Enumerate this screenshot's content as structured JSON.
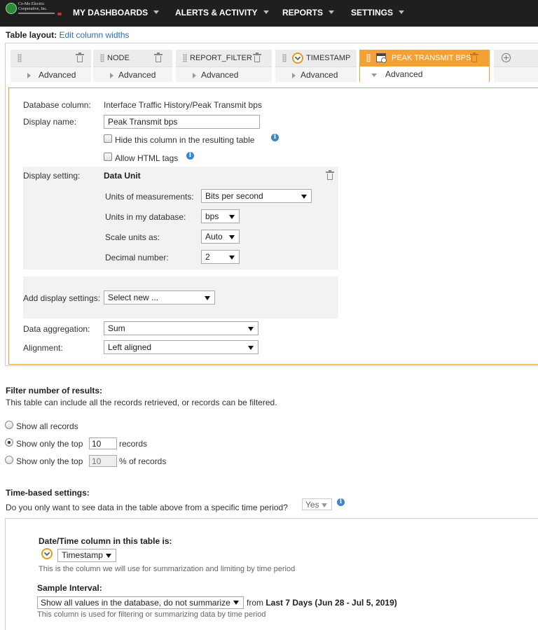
{
  "logo": {
    "line1": "Co-Mo Electric",
    "line2": "Cooperative, Inc."
  },
  "nav": [
    {
      "label": "MY DASHBOARDS"
    },
    {
      "label": "ALERTS & ACTIVITY"
    },
    {
      "label": "REPORTS"
    },
    {
      "label": "SETTINGS"
    }
  ],
  "table_layout": {
    "label": "Table layout:",
    "link": "Edit column widths"
  },
  "columns": [
    {
      "title": "",
      "sub": "Advanced"
    },
    {
      "title": "NODE",
      "sub": "Advanced"
    },
    {
      "title": "REPORT_FILTER",
      "sub": "Advanced"
    },
    {
      "title": "TIMESTAMP",
      "sub": "Advanced"
    },
    {
      "title": "PEAK TRANSMIT BPS",
      "sub": "Advanced"
    }
  ],
  "editor": {
    "db_column_label": "Database column:",
    "db_column_value": "Interface Traffic History/Peak Transmit bps",
    "display_name_label": "Display name:",
    "display_name_value": "Peak Transmit bps",
    "hide_label": "Hide this column in the resulting table",
    "html_label": "Allow HTML tags",
    "display_setting_label": "Display setting:",
    "data_unit_title": "Data Unit",
    "units_label": "Units of measurements:",
    "units_value": "Bits per second",
    "db_units_label": "Units in my database:",
    "db_units_value": "bps",
    "scale_label": "Scale units as:",
    "scale_value": "Auto",
    "decimal_label": "Decimal number:",
    "decimal_value": "2",
    "add_display_label": "Add display settings:",
    "add_display_value": "Select new ...",
    "aggregation_label": "Data aggregation:",
    "aggregation_value": "Sum",
    "alignment_label": "Alignment:",
    "alignment_value": "Left aligned"
  },
  "filter": {
    "title": "Filter number of results:",
    "desc": "This table can include all the records retrieved, or records can be filtered.",
    "opt_all": "Show all records",
    "opt_top_prefix": "Show only the top",
    "opt_top_value": "10",
    "opt_top_suffix": "records",
    "opt_pct_prefix": "Show only the top",
    "opt_pct_value": "10",
    "opt_pct_suffix": "% of records"
  },
  "time": {
    "title": "Time-based settings:",
    "question": "Do you only want to see data in the table above from a specific time period?",
    "question_value": "Yes",
    "datetime_label": "Date/Time column in this table is:",
    "datetime_value": "Timestamp",
    "datetime_hint": "This is the column we will use for summarization and limiting by time period",
    "sample_label": "Sample Interval:",
    "sample_value": "Show all values in the database, do not summarize",
    "from_label": "from",
    "from_value": "Last 7 Days (Jun 28 - Jul 5, 2019)",
    "sample_hint": "This column is used for filtering or summarizing data by time period"
  }
}
